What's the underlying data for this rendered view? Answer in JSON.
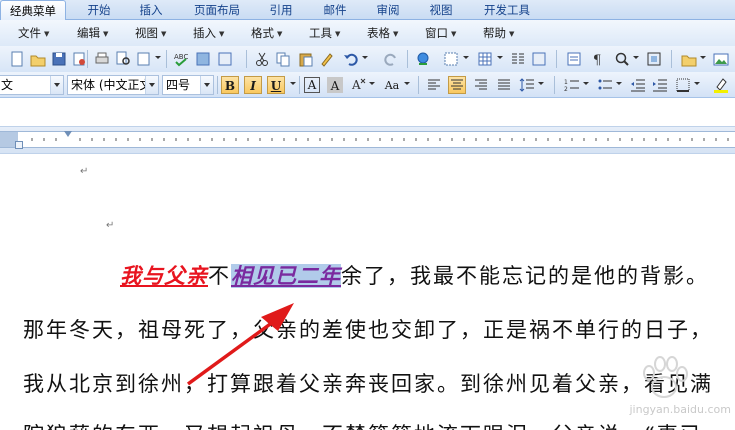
{
  "ribbon_tabs": [
    "经典菜单",
    "开始",
    "插入",
    "页面布局",
    "引用",
    "邮件",
    "审阅",
    "视图",
    "开发工具"
  ],
  "menus": [
    "文件",
    "编辑",
    "视图",
    "插入",
    "格式",
    "工具",
    "表格",
    "窗口",
    "帮助"
  ],
  "toolbar": {
    "style_value": "文",
    "font_value": "宋体 (中文正文",
    "size_value": "四号",
    "bold_label": "B",
    "italic_label": "I",
    "underline_label": "U",
    "char_border_label": "A",
    "char_shade_label": "A",
    "change_case_label": "Aa"
  },
  "document": {
    "para_mark": "↵",
    "line1_part1": "我与父亲",
    "line1_part2": "不",
    "line1_selected": "相见已二年",
    "line1_part3": "余了，我最不能忘记的是他的背影。",
    "line2": "那年冬天，祖母死了，父亲的差使也交卸了，正是祸不单行的日子，",
    "line3": "我从北京到徐州，打算跟着父亲奔丧回家。到徐州见着父亲，看见满",
    "line4": "院狼藉的东西，又想起祖母，不禁簌簌地流下眼泪。父亲说，“事已"
  },
  "watermark": "jingyan.baidu.com",
  "colors": {
    "title_red": "#e8141f",
    "selected_purple": "#7a2a9f",
    "selection_highlight": "#b1cbea",
    "annotation_arrow": "#e01a1a"
  }
}
